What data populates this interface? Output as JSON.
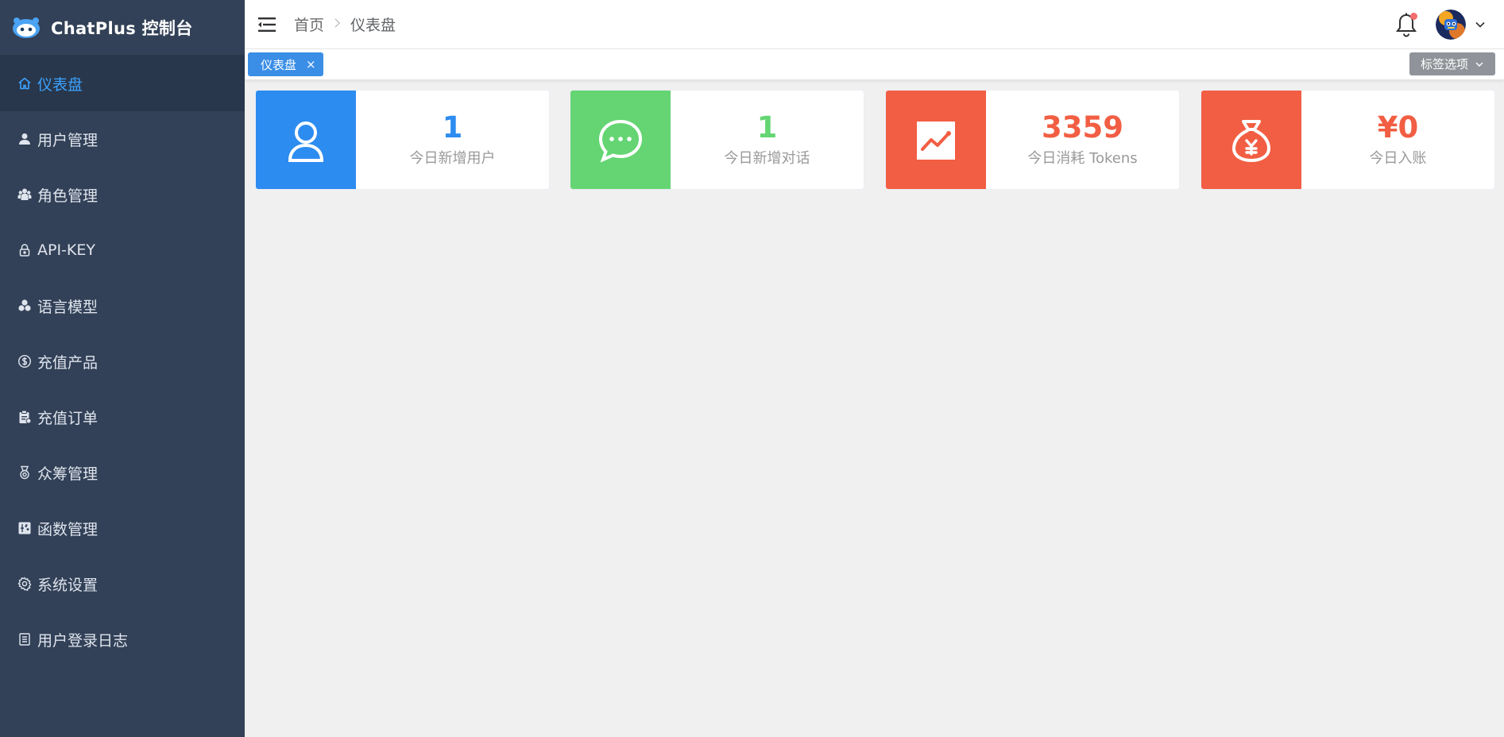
{
  "app": {
    "title": "ChatPlus 控制台"
  },
  "sidebar": {
    "items": [
      {
        "label": "仪表盘",
        "icon": "home-icon",
        "active": true
      },
      {
        "label": "用户管理",
        "icon": "user-icon",
        "active": false
      },
      {
        "label": "角色管理",
        "icon": "role-icon",
        "active": false
      },
      {
        "label": "API-KEY",
        "icon": "lock-icon",
        "active": false
      },
      {
        "label": "语言模型",
        "icon": "model-icon",
        "active": false
      },
      {
        "label": "充值产品",
        "icon": "dollar-circle-icon",
        "active": false
      },
      {
        "label": "充值订单",
        "icon": "clipboard-icon",
        "active": false
      },
      {
        "label": "众筹管理",
        "icon": "medal-icon",
        "active": false
      },
      {
        "label": "函数管理",
        "icon": "function-icon",
        "active": false
      },
      {
        "label": "系统设置",
        "icon": "gear-icon",
        "active": false
      },
      {
        "label": "用户登录日志",
        "icon": "log-icon",
        "active": false
      }
    ]
  },
  "header": {
    "breadcrumb": {
      "home": "首页",
      "current": "仪表盘"
    },
    "notifications_unread": true
  },
  "tags": {
    "open": [
      {
        "label": "仪表盘",
        "close": "×"
      }
    ],
    "options_label": "标签选项"
  },
  "stats": [
    {
      "value": "1",
      "label": "今日新增用户",
      "icon": "user-outline-icon",
      "bg": "#2d8cf0",
      "color": "#2d8cf0"
    },
    {
      "value": "1",
      "label": "今日新增对话",
      "icon": "chat-bubble-icon",
      "bg": "#64d572",
      "color": "#64d572"
    },
    {
      "value": "3359",
      "label": "今日消耗 Tokens",
      "icon": "trend-chart-icon",
      "bg": "#f25e43",
      "color": "#f25e43"
    },
    {
      "value": "¥0",
      "label": "今日入账",
      "icon": "money-bag-icon",
      "bg": "#f25e43",
      "color": "#f25e43"
    }
  ],
  "colors": {
    "sidebar_bg": "#324157",
    "sidebar_active_bg": "#28374c",
    "accent": "#3da3ff",
    "tag_active": "#3a8ee6"
  }
}
